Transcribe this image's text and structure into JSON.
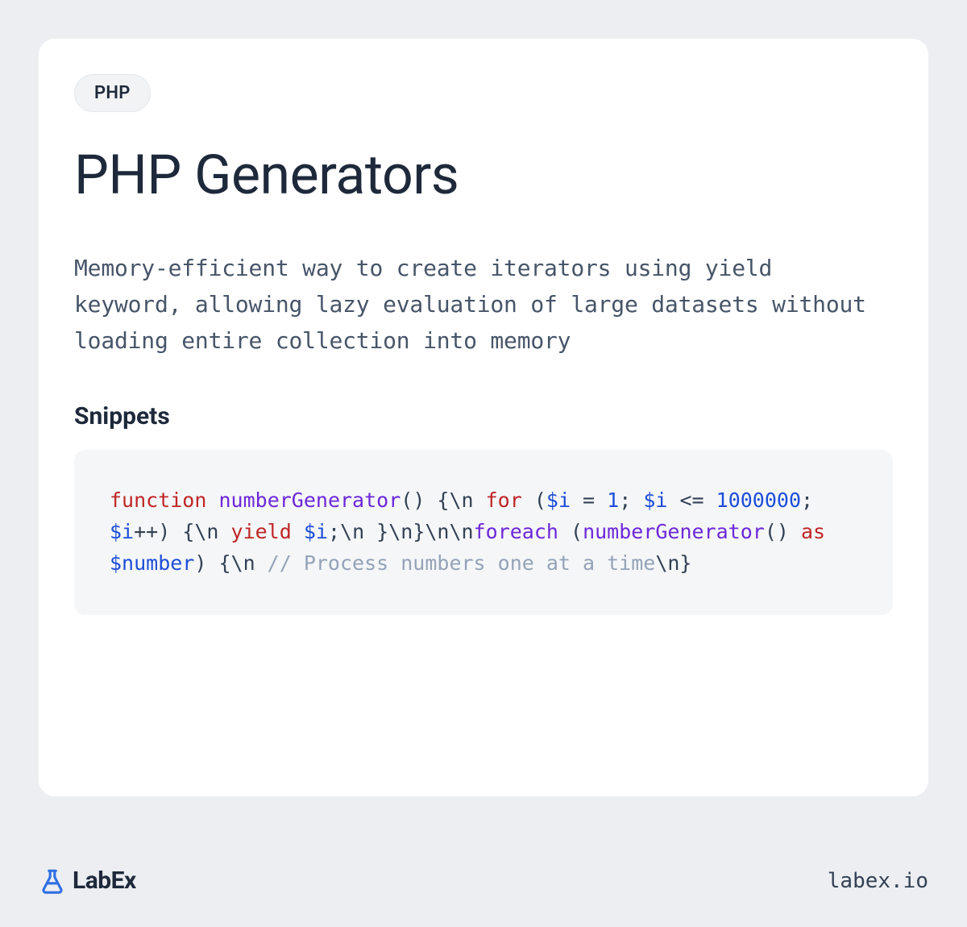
{
  "badge": "PHP",
  "title": "PHP Generators",
  "description": "Memory-efficient way to create iterators using yield keyword, allowing lazy evaluation of large datasets without loading entire collection into memory",
  "snippets_heading": "Snippets",
  "code": {
    "tokens": [
      {
        "t": "function",
        "c": "tok-kw"
      },
      {
        "t": " ",
        "c": "tok-punct"
      },
      {
        "t": "numberGenerator",
        "c": "tok-fn"
      },
      {
        "t": "() {\\n    ",
        "c": "tok-punct"
      },
      {
        "t": "for",
        "c": "tok-kw"
      },
      {
        "t": " (",
        "c": "tok-punct"
      },
      {
        "t": "$i",
        "c": "tok-var"
      },
      {
        "t": " = ",
        "c": "tok-punct"
      },
      {
        "t": "1",
        "c": "tok-num"
      },
      {
        "t": "; ",
        "c": "tok-punct"
      },
      {
        "t": "$i",
        "c": "tok-var"
      },
      {
        "t": " <= ",
        "c": "tok-punct"
      },
      {
        "t": "1000000",
        "c": "tok-num"
      },
      {
        "t": "; ",
        "c": "tok-punct"
      },
      {
        "t": "$i",
        "c": "tok-var"
      },
      {
        "t": "++) {\\n        ",
        "c": "tok-punct"
      },
      {
        "t": "yield",
        "c": "tok-kw"
      },
      {
        "t": " ",
        "c": "tok-punct"
      },
      {
        "t": "$i",
        "c": "tok-var"
      },
      {
        "t": ";\\n    }\\n}\\n\\n",
        "c": "tok-punct"
      },
      {
        "t": "foreach",
        "c": "tok-fn"
      },
      {
        "t": " (",
        "c": "tok-punct"
      },
      {
        "t": "numberGenerator",
        "c": "tok-fn"
      },
      {
        "t": "() ",
        "c": "tok-punct"
      },
      {
        "t": "as",
        "c": "tok-kw"
      },
      {
        "t": " ",
        "c": "tok-punct"
      },
      {
        "t": "$number",
        "c": "tok-var"
      },
      {
        "t": ") {\\n    ",
        "c": "tok-punct"
      },
      {
        "t": "// Process numbers one at a time",
        "c": "tok-cmt"
      },
      {
        "t": "\\n}",
        "c": "tok-punct"
      }
    ]
  },
  "footer": {
    "brand": "LabEx",
    "site": "labex.io"
  }
}
